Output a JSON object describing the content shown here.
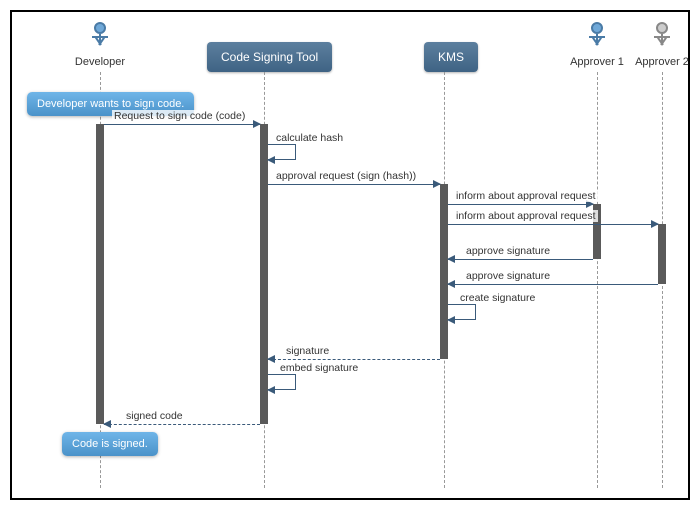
{
  "participants": {
    "developer": "Developer",
    "codeSigningTool": "Code Signing Tool",
    "kms": "KMS",
    "approver1": "Approver 1",
    "approver2": "Approver 2"
  },
  "notes": {
    "start": "Developer wants to sign code.",
    "end": "Code is signed."
  },
  "messages": {
    "m1": "Request to sign code (code)",
    "m2": "calculate hash",
    "m3": "approval request (sign (hash))",
    "m4": "inform about approval request",
    "m5": "inform about approval request",
    "m6": "approve signature",
    "m7": "approve signature",
    "m8": "create signature",
    "m9": "signature",
    "m10": "embed signature",
    "m11": "signed code"
  },
  "chart_data": {
    "type": "uml-sequence",
    "participants": [
      {
        "id": "dev",
        "name": "Developer",
        "kind": "actor"
      },
      {
        "id": "cst",
        "name": "Code Signing Tool",
        "kind": "component"
      },
      {
        "id": "kms",
        "name": "KMS",
        "kind": "component"
      },
      {
        "id": "ap1",
        "name": "Approver 1",
        "kind": "actor"
      },
      {
        "id": "ap2",
        "name": "Approver 2",
        "kind": "actor"
      }
    ],
    "interactions": [
      {
        "type": "note",
        "at": "dev",
        "text": "Developer wants to sign code."
      },
      {
        "from": "dev",
        "to": "cst",
        "label": "Request to sign code (code)",
        "style": "sync"
      },
      {
        "from": "cst",
        "to": "cst",
        "label": "calculate hash",
        "style": "self"
      },
      {
        "from": "cst",
        "to": "kms",
        "label": "approval request (sign (hash))",
        "style": "sync"
      },
      {
        "from": "kms",
        "to": "ap1",
        "label": "inform about approval request",
        "style": "sync"
      },
      {
        "from": "kms",
        "to": "ap2",
        "label": "inform about approval request",
        "style": "sync"
      },
      {
        "from": "ap1",
        "to": "kms",
        "label": "approve signature",
        "style": "sync"
      },
      {
        "from": "ap2",
        "to": "kms",
        "label": "approve signature",
        "style": "sync"
      },
      {
        "from": "kms",
        "to": "kms",
        "label": "create signature",
        "style": "self"
      },
      {
        "from": "kms",
        "to": "cst",
        "label": "signature",
        "style": "return"
      },
      {
        "from": "cst",
        "to": "cst",
        "label": "embed signature",
        "style": "self"
      },
      {
        "from": "cst",
        "to": "dev",
        "label": "signed code",
        "style": "return"
      },
      {
        "type": "note",
        "at": "dev",
        "text": "Code is signed."
      }
    ]
  }
}
